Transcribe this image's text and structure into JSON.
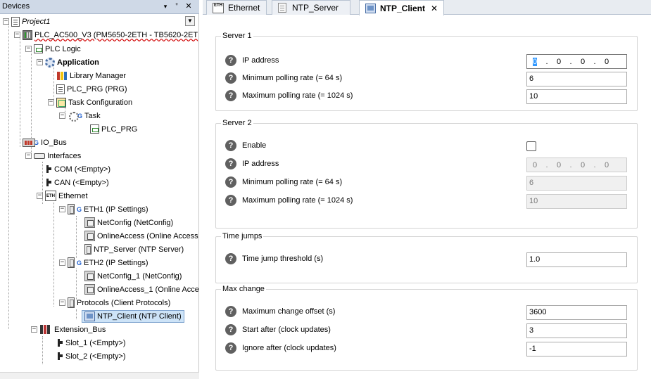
{
  "devices_panel": {
    "title": "Devices",
    "dropdown_glyph": "▾",
    "pin_glyph": "ᐩ",
    "close_glyph": "✕",
    "tree": [
      {
        "label": "Project1"
      },
      {
        "label": "PLC_AC500_V3 (PM5650-2ETH - TB5620-2ET"
      },
      {
        "label": "PLC Logic"
      },
      {
        "label": "Application"
      },
      {
        "label": "Library Manager"
      },
      {
        "label": "PLC_PRG (PRG)"
      },
      {
        "label": "Task Configuration"
      },
      {
        "label": "Task"
      },
      {
        "label": "PLC_PRG"
      },
      {
        "label": "IO_Bus"
      },
      {
        "label": "Interfaces"
      },
      {
        "label": "COM (<Empty>)"
      },
      {
        "label": "CAN (<Empty>)"
      },
      {
        "label": "Ethernet"
      },
      {
        "label": "ETH1 (IP Settings)"
      },
      {
        "label": "NetConfig (NetConfig)"
      },
      {
        "label": "OnlineAccess (Online Access"
      },
      {
        "label": "NTP_Server (NTP Server)"
      },
      {
        "label": "ETH2 (IP Settings)"
      },
      {
        "label": "NetConfig_1 (NetConfig)"
      },
      {
        "label": "OnlineAccess_1 (Online Acce"
      },
      {
        "label": "Protocols (Client Protocols)"
      },
      {
        "label": "NTP_Client (NTP Client)"
      },
      {
        "label": "Extension_Bus"
      },
      {
        "label": "Slot_1 (<Empty>)"
      },
      {
        "label": "Slot_2 (<Empty>)"
      }
    ],
    "expand_glyphs": {
      "expanded": "−",
      "collapsed": "+"
    }
  },
  "tabs": [
    {
      "label": "Ethernet",
      "icon_text": "ETH"
    },
    {
      "label": "NTP_Server"
    },
    {
      "label": "NTP_Client",
      "close_glyph": "✕"
    }
  ],
  "server1": {
    "title": "Server 1",
    "ip_label": "IP address",
    "ip": [
      "0",
      "0",
      "0",
      "0"
    ],
    "min_label": "Minimum polling rate (= 64 s)",
    "min_value": "6",
    "max_label": "Maximum polling rate (= 1024 s)",
    "max_value": "10"
  },
  "server2": {
    "title": "Server 2",
    "enable_label": "Enable",
    "enabled": false,
    "ip_label": "IP address",
    "ip": [
      "0",
      "0",
      "0",
      "0"
    ],
    "min_label": "Minimum polling rate (= 64 s)",
    "min_value": "6",
    "max_label": "Maximum polling rate (= 1024 s)",
    "max_value": "10"
  },
  "time_jumps": {
    "title": "Time jumps",
    "threshold_label": "Time jump threshold (s)",
    "threshold_value": "1.0"
  },
  "max_change": {
    "title": "Max change",
    "offset_label": "Maximum change offset (s)",
    "offset_value": "3600",
    "start_label": "Start after (clock updates)",
    "start_value": "3",
    "ignore_label": "Ignore after (clock updates)",
    "ignore_value": "-1"
  },
  "help_glyph": "?",
  "ip_separator": ".",
  "colors": {
    "accent": "#3399ff",
    "header": "#cfd9e7",
    "selection": "#cde3f7"
  }
}
